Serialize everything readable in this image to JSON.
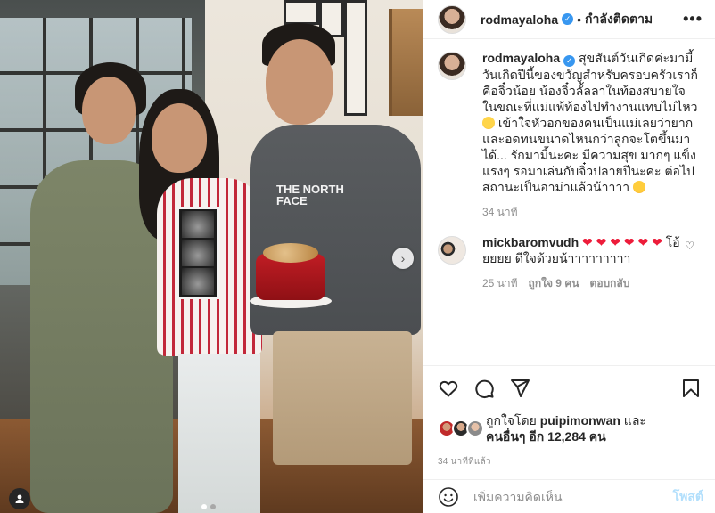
{
  "header": {
    "username": "rodmayaloha",
    "separator": "•",
    "follow_state": "กำลังติดตาม",
    "more": "•••"
  },
  "caption": {
    "username": "rodmayaloha",
    "text_1": "สุขสันต์วันเกิดค่ะมามี้ วันเกิดปีนี้ของขวัญสำหรับครอบครัวเราก็คือจิ๋วน้อย น้องจิ๋วลั้ลลาในท้องสบายใจ ในขณะที่แม่แพ้ท้องไปทำงานแทบไม่ไหว",
    "text_2": " เข้าใจหัวอกของคนเป็นแม่เลยว่ายากและอดทนขนาดไหนกว่าลูกจะโตขึ้นมาได้... รักมามี้นะคะ มีความสุข มากๆ แข็งแรงๆ รอมาเล่นกับจิ๋วปลายปีนะคะ ต่อไปสถานะเป็นอาม่าแล้วน้าาาา ",
    "time": "34 นาที"
  },
  "comment": {
    "username": "mickbaromvudh",
    "hearts": "❤ ❤ ❤ ❤ ❤ ❤",
    "text": " โอ้ยยยย ดีใจด้วยน้าาาาาาาาา",
    "time": "25 นาที",
    "likes": "ถูกใจ 9 คน",
    "reply": "ตอบกลับ"
  },
  "likes": {
    "prefix": "ถูกใจโดย ",
    "first_user": "puipimonwan",
    "middle": " และ",
    "others": "คนอื่นๆ อีก 12,284 คน"
  },
  "post_time": "34 นาทีที่แล้ว",
  "add_comment": {
    "placeholder": "เพิ่มความคิดเห็น",
    "post_label": "โพสต์"
  },
  "photo": {
    "shirt_text": "THE NORTH FACE"
  },
  "colors": {
    "verified": "#3897f0",
    "heart": "#ed1c3a",
    "post_button": "#b2dffc",
    "muted": "#8e8e8e"
  }
}
